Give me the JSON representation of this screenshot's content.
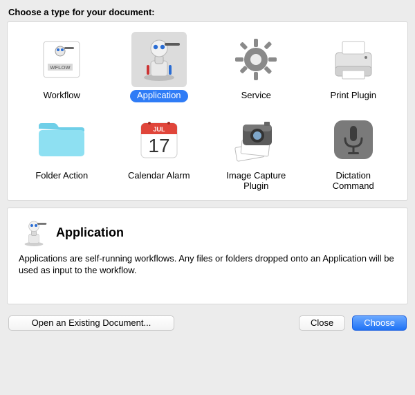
{
  "prompt": "Choose a type for your document:",
  "types": [
    {
      "label": "Workflow",
      "icon": "workflow",
      "selected": false
    },
    {
      "label": "Application",
      "icon": "application",
      "selected": true
    },
    {
      "label": "Service",
      "icon": "service",
      "selected": false
    },
    {
      "label": "Print Plugin",
      "icon": "print",
      "selected": false
    },
    {
      "label": "Folder Action",
      "icon": "folder",
      "selected": false
    },
    {
      "label": "Calendar Alarm",
      "icon": "calendar",
      "selected": false
    },
    {
      "label": "Image Capture Plugin",
      "icon": "imagecapture",
      "selected": false
    },
    {
      "label": "Dictation Command",
      "icon": "dictation",
      "selected": false
    }
  ],
  "calendar": {
    "month": "JUL",
    "day": "17"
  },
  "wflow_badge": "WFLOW",
  "selected_detail": {
    "title": "Application",
    "icon": "application",
    "description": "Applications are self-running workflows. Any files or folders dropped onto an Application will be used as input to the workflow."
  },
  "buttons": {
    "open_existing": "Open an Existing Document...",
    "close": "Close",
    "choose": "Choose"
  }
}
